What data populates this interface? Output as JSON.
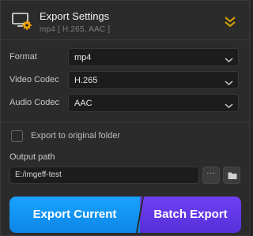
{
  "header": {
    "title": "Export Settings",
    "subtitle": "mp4 [ H.265, AAC ]",
    "icon": "monitor-gear-icon",
    "collapse_icon": "double-chevron-down-icon"
  },
  "settings": {
    "format": {
      "label": "Format",
      "value": "mp4"
    },
    "video_codec": {
      "label": "Video Codec",
      "value": "H.265"
    },
    "audio_codec": {
      "label": "Audio Codec",
      "value": "AAC"
    }
  },
  "export_to_original": {
    "label": "Export to original folder",
    "checked": false
  },
  "output": {
    "label": "Output path",
    "value": "E:/imgeff-test",
    "more_label": "···"
  },
  "actions": {
    "export_current": "Export Current",
    "batch_export": "Batch Export"
  },
  "colors": {
    "accent_blue": "#1aa3ff",
    "accent_purple": "#6f40f2",
    "collapse_yellow": "#e0a800",
    "icon_gear": "#f0a500"
  }
}
